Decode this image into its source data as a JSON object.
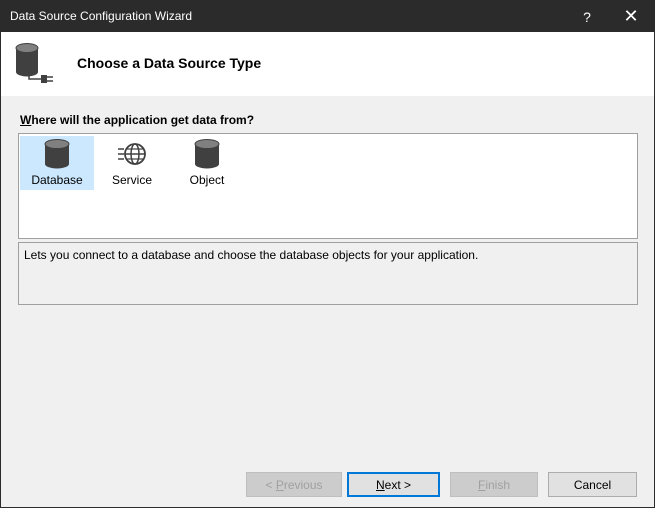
{
  "window": {
    "title": "Data Source Configuration Wizard",
    "help_label": "?",
    "close_label": "✕"
  },
  "header": {
    "title": "Choose a Data Source Type",
    "icon": "database-connect-icon"
  },
  "question": {
    "accel": "W",
    "rest": "here will the application get data from?"
  },
  "sources": [
    {
      "label": "Database",
      "icon": "database-icon",
      "selected": true
    },
    {
      "label": "Service",
      "icon": "globe-service-icon",
      "selected": false
    },
    {
      "label": "Object",
      "icon": "object-cylinder-icon",
      "selected": false
    }
  ],
  "description": "Lets you connect to a database and choose the database objects for your application.",
  "buttons": {
    "previous": {
      "prefix": "< ",
      "accel": "P",
      "rest": "revious",
      "enabled": false
    },
    "next": {
      "accel": "N",
      "rest": "ext >",
      "enabled": true
    },
    "finish": {
      "accel": "F",
      "rest": "inish",
      "enabled": false
    },
    "cancel": {
      "label": "Cancel",
      "enabled": true
    }
  },
  "colors": {
    "titlebar": "#2b2b2b",
    "selection": "#cce8ff",
    "default_button_border": "#0078d7"
  }
}
